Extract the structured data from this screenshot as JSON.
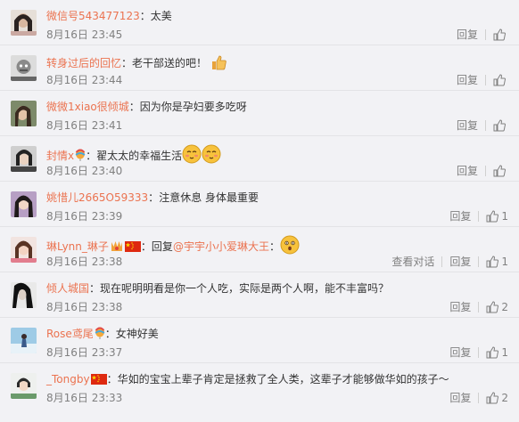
{
  "comments": [
    {
      "user": "微信号543477123",
      "sep": "：",
      "text": "太美",
      "time": "8月16日 23:45",
      "reply": "回复",
      "likes": ""
    },
    {
      "user": "转身过后的回忆",
      "sep": "：",
      "text": "老干部送的吧！",
      "time": "8月16日 23:44",
      "reply": "回复",
      "likes": ""
    },
    {
      "user": "微微1xiao很倾城",
      "sep": "：",
      "text": "因为你是孕妇要多吃呀",
      "time": "8月16日 23:41",
      "reply": "回复",
      "likes": ""
    },
    {
      "user": "封情x",
      "sep": "：",
      "text": "翟太太的幸福生活",
      "time": "8月16日 23:40",
      "reply": "回复",
      "likes": ""
    },
    {
      "user": "姚惜儿2665O59333",
      "sep": "：",
      "text": "注意休息 身体最重要",
      "time": "8月16日 23:39",
      "reply": "回复",
      "likes": "1"
    },
    {
      "user": "琳Lynn_琳子",
      "sep": "：",
      "text_prefix": "回复",
      "mention": "@宇宇小小爱琳大王",
      "text": "：",
      "time": "8月16日 23:38",
      "view_dialog": "查看对话",
      "reply": "回复",
      "likes": "1"
    },
    {
      "user": "倾人城国",
      "sep": "：",
      "text": "现在呢明明看是你一个人吃，实际是两个人啊，能不丰富吗？",
      "time": "8月16日 23:38",
      "reply": "回复",
      "likes": "2"
    },
    {
      "user": "Rose鸢尾",
      "sep": "：",
      "text": "女神好美",
      "time": "8月16日 23:37",
      "reply": "回复",
      "likes": "1"
    },
    {
      "user": "_Tongby",
      "sep": "：",
      "text": "华如的宝宝上辈子肯定是拯救了全人类，这辈子才能够做华如的孩子～",
      "time": "8月16日 23:33",
      "reply": "回复",
      "likes": "2"
    }
  ],
  "colors": {
    "username": "#eb7350",
    "time": "#808080",
    "text": "#333333",
    "bg": "#f2f2f5"
  }
}
